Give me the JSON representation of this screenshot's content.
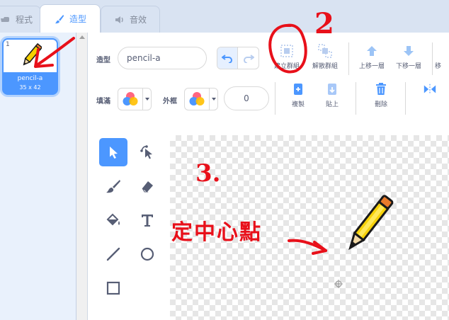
{
  "tabs": [
    {
      "label": "程式",
      "icon": "code-icon"
    },
    {
      "label": "造型",
      "icon": "brush-icon",
      "active": true
    },
    {
      "label": "音效",
      "icon": "speaker-icon"
    }
  ],
  "costume_list": {
    "index": "1",
    "name": "pencil-a",
    "size": "35 x 42"
  },
  "toolbar": {
    "costume_label": "造型",
    "costume_name": "pencil-a",
    "group_label": "建立群組",
    "ungroup_label": "解散群組",
    "forward_label": "上移一層",
    "backward_label": "下移一層",
    "front_label": "移",
    "fill_label": "填滿",
    "outline_label": "外框",
    "outline_width": "0",
    "copy_label": "複製",
    "paste_label": "貼上",
    "delete_label": "刪除"
  },
  "annotations": {
    "step2": "2",
    "step3": "3.",
    "center_text": "定中心點"
  },
  "colors": {
    "accent": "#4c97ff",
    "annotation": "#e8101a",
    "delete": "#4c97ff"
  }
}
